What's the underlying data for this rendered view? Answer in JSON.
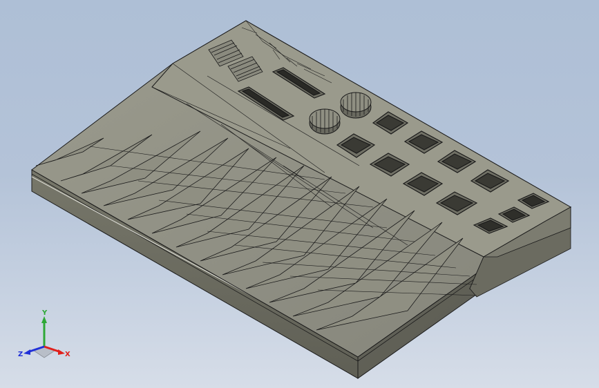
{
  "view": {
    "background_top": "#aebfd6",
    "background_bottom": "#d6dde8",
    "model_face_color": "#8d8d80",
    "model_edge_color": "#1a1a1a"
  },
  "triad": {
    "x_label": "X",
    "y_label": "Y",
    "z_label": "Z",
    "x_color": "#e0201c",
    "y_color": "#2ea836",
    "z_color": "#2030d8"
  }
}
